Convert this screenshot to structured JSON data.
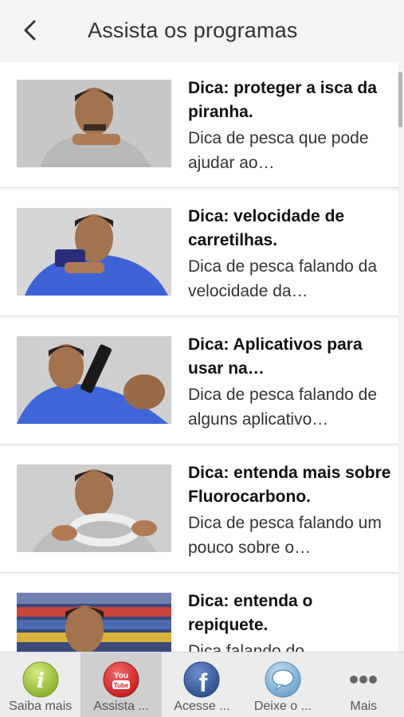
{
  "header": {
    "title": "Assista os programas"
  },
  "videos": [
    {
      "title": "Dica: proteger a isca da piranha.",
      "description": "Dica de pesca que pode ajudar ao…"
    },
    {
      "title": "Dica: velocidade de carretilhas.",
      "description": "Dica de pesca falando da velocidade da…"
    },
    {
      "title": "Dica: Aplicativos para usar na…",
      "description": "Dica de pesca falando de alguns aplicativo…"
    },
    {
      "title": "Dica: entenda mais sobre Fluorocarbono.",
      "description": "Dica de pesca falando um pouco sobre o…"
    },
    {
      "title": "Dica: entenda o repiquete.",
      "description": "Dica falando do…"
    }
  ],
  "tabs": [
    {
      "label": "Saiba mais",
      "icon": "info-icon"
    },
    {
      "label": "Assista ...",
      "icon": "youtube-icon"
    },
    {
      "label": "Acesse ...",
      "icon": "facebook-icon"
    },
    {
      "label": "Deixe o ...",
      "icon": "speech-bubble-icon"
    },
    {
      "label": "Mais",
      "icon": "more-dots-icon"
    }
  ],
  "colors": {
    "background": "#f4f4f4",
    "active_tab": "#cfcfcf",
    "info_green": "#9cc33a",
    "youtube_red": "#d92b2b",
    "facebook_blue": "#3b5b9c",
    "bubble_blue": "#7fb2d6"
  }
}
